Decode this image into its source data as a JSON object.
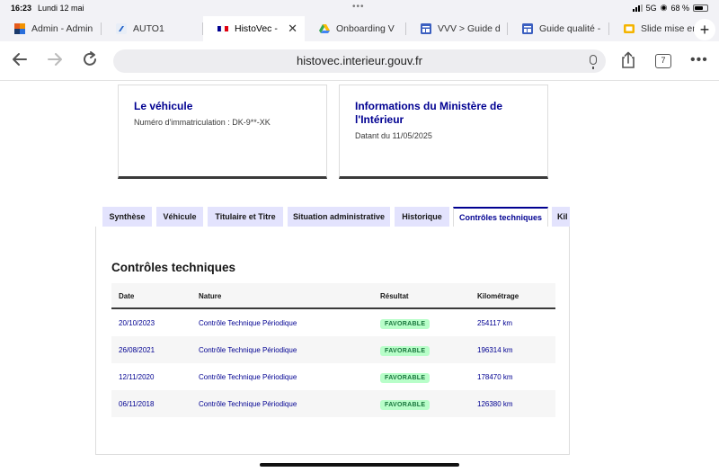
{
  "status_bar": {
    "time": "16:23",
    "date": "Lundi 12 mai",
    "network": "5G",
    "battery": "68 %"
  },
  "browser_tabs": [
    {
      "label": "Admin - Admin",
      "icon": "admin-favicon",
      "active": false
    },
    {
      "label": "AUTO1",
      "icon": "auto1-favicon",
      "active": false
    },
    {
      "label": "HistoVec -",
      "icon": "french-flag-favicon",
      "active": true
    },
    {
      "label": "Onboarding V",
      "icon": "google-drive-favicon",
      "active": false
    },
    {
      "label": "VVV > Guide d",
      "icon": "docs-favicon",
      "active": false
    },
    {
      "label": "Guide qualité -",
      "icon": "docs-favicon",
      "active": false
    },
    {
      "label": "Slide mise en s",
      "icon": "slides-favicon",
      "active": false
    }
  ],
  "address_bar": {
    "url": "histovec.interieur.gouv.fr",
    "tab_count": "7"
  },
  "cards": [
    {
      "title": "Le véhicule",
      "lines": [
        "Numéro d'immatriculation : DK-9**-XK"
      ]
    },
    {
      "title": "Informations du Ministère de l'Intérieur",
      "lines": [
        "Datant du 11/05/2025"
      ]
    }
  ],
  "page_tabs": [
    "Synthèse",
    "Véhicule",
    "Titulaire et Titre",
    "Situation administrative",
    "Historique",
    "Contrôles techniques",
    "Kil"
  ],
  "active_page_tab": "Contrôles techniques",
  "section_title": "Contrôles techniques",
  "table": {
    "headers": [
      "Date",
      "Nature",
      "Résultat",
      "Kilométrage"
    ],
    "rows": [
      [
        "20/10/2023",
        "Contrôle Technique Périodique",
        "FAVORABLE",
        "254117 km"
      ],
      [
        "26/08/2021",
        "Contrôle Technique Périodique",
        "FAVORABLE",
        "196314 km"
      ],
      [
        "12/11/2020",
        "Contrôle Technique Périodique",
        "FAVORABLE",
        "178470 km"
      ],
      [
        "06/11/2018",
        "Contrôle Technique Périodique",
        "FAVORABLE",
        "126380 km"
      ]
    ]
  },
  "colors": {
    "accent": "#000091",
    "badge_bg": "#b8fec9",
    "badge_text": "#18753c",
    "tab_bg": "#e3e3fd"
  }
}
